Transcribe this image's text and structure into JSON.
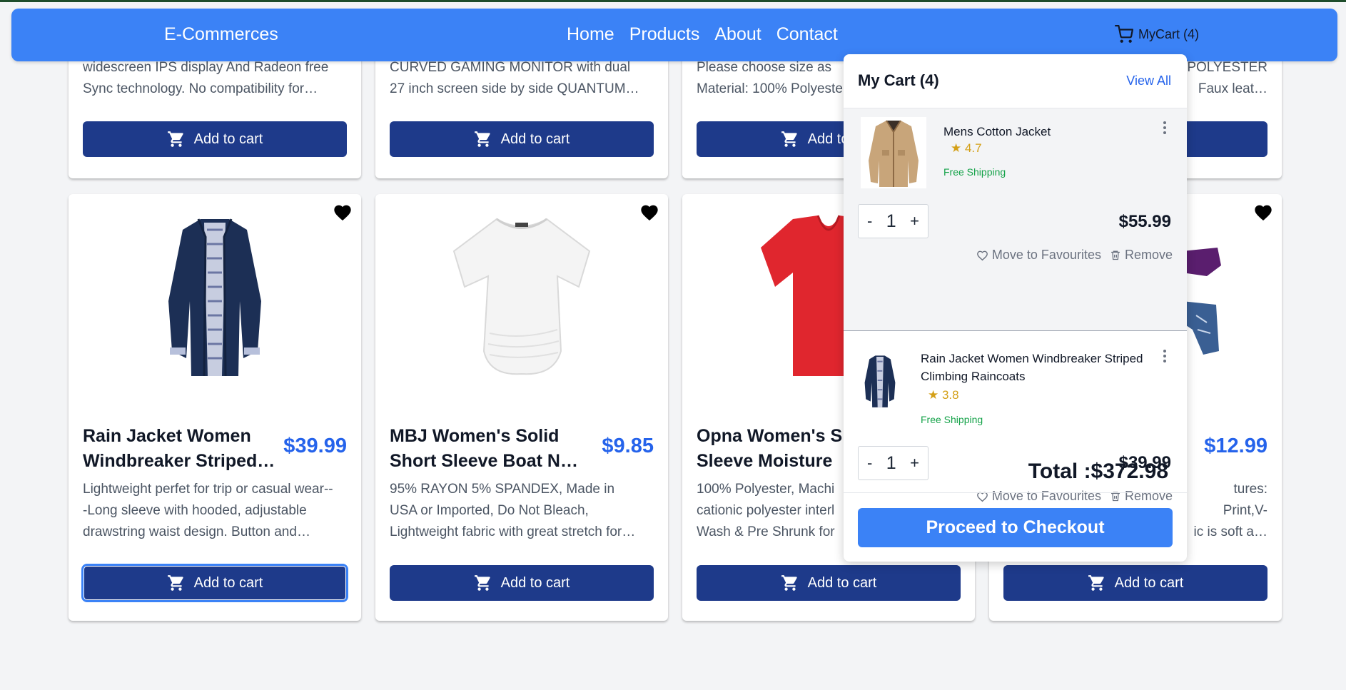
{
  "navbar": {
    "brand": "E-Commerces",
    "links": [
      "Home",
      "Products",
      "About",
      "Contact"
    ],
    "cart_label": "MyCart (4)"
  },
  "add_to_cart_label": "Add to cart",
  "top_row": [
    {
      "desc": [
        "widescreen IPS display And Radeon free",
        "Sync technology. No compatibility for…"
      ]
    },
    {
      "desc": [
        "CURVED GAMING MONITOR with dual",
        "27 inch screen side by side QUANTUM…"
      ]
    },
    {
      "desc": [
        "Please choose size as",
        "Material: 100% Polyeste"
      ]
    },
    {
      "desc": [
        "POLYESTER",
        "Faux leat…"
      ]
    }
  ],
  "products": [
    {
      "title": [
        "Rain Jacket Women",
        "Windbreaker Striped…"
      ],
      "price": "$39.99",
      "desc": [
        "Lightweight perfet for trip or casual wear--",
        "-Long sleeve with hooded, adjustable",
        "drawstring waist design. Button and…"
      ]
    },
    {
      "title": [
        "MBJ Women's Solid",
        "Short Sleeve Boat Nec…"
      ],
      "price": "$9.85",
      "desc": [
        "95% RAYON 5% SPANDEX, Made in",
        "USA or Imported, Do Not Bleach,",
        "Lightweight fabric with great stretch for…"
      ]
    },
    {
      "title": [
        "Opna Women's S",
        "Sleeve Moisture"
      ],
      "price": "",
      "desc": [
        "100% Polyester, Machi",
        "cationic polyester interl",
        "Wash & Pre Shrunk for"
      ]
    },
    {
      "title": [
        "",
        ""
      ],
      "price": "$12.99",
      "desc": [
        "tures:",
        "Print,V-",
        "ic is soft a…"
      ]
    }
  ],
  "cart": {
    "title": "My Cart (4)",
    "view_all": "View All",
    "move_label": "Move to Favourites",
    "remove_label": "Remove",
    "items": [
      {
        "name": [
          "Mens Cotton Jacket"
        ],
        "rating": "★ 4.7",
        "shipping": "Free Shipping",
        "qty": "1",
        "price": "$55.99"
      },
      {
        "name": [
          "Rain Jacket Women Windbreaker Striped",
          "Climbing Raincoats"
        ],
        "rating": "★ 3.8",
        "shipping": "Free Shipping",
        "qty": "1",
        "price": "$39.99"
      }
    ],
    "total": "Total :$372.98",
    "checkout": "Proceed to Checkout",
    "minus": "-",
    "plus": "+"
  },
  "colors": {
    "navbar": "#3b82f6",
    "button": "#1e3a8a",
    "price": "#2563eb",
    "rating": "#d4a017",
    "shipping": "#16a34a"
  },
  "icons": [
    "cart-icon",
    "heart-icon",
    "kebab-icon",
    "heart-outline-icon",
    "trash-icon"
  ]
}
